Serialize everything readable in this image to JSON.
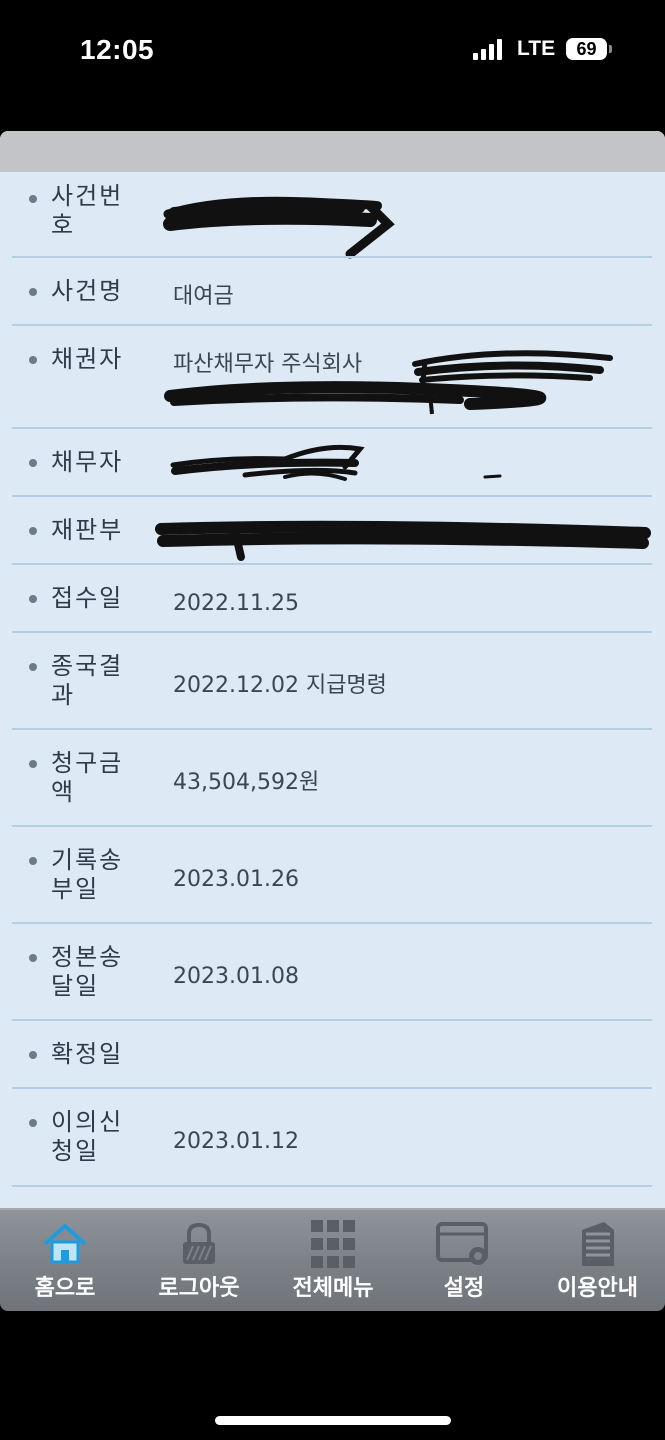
{
  "status_bar": {
    "time": "12:05",
    "network": "LTE",
    "battery": "69",
    "signal_icon": "signal-bars-icon"
  },
  "case": {
    "case_number": {
      "label": "사건번호",
      "value": ""
    },
    "case_name": {
      "label": "사건명",
      "value": "대여금"
    },
    "creditor": {
      "label": "채권자",
      "value": "파산채무자 주식회사"
    },
    "debtor": {
      "label": "채무자",
      "value": ""
    },
    "court_division": {
      "label": "재판부",
      "value": ""
    },
    "filing_date": {
      "label": "접수일",
      "value": "2022.11.25"
    },
    "final_result": {
      "label": "종국결과",
      "value": "2022.12.02 지급명령"
    },
    "claim_amount": {
      "label": "청구금액",
      "value": "43,504,592원"
    },
    "record_sent_date": {
      "label": "기록송부일",
      "value": "2023.01.26"
    },
    "original_delivered_date": {
      "label": "정본송달일",
      "value": "2023.01.08"
    },
    "confirmed_date": {
      "label": "확정일",
      "value": ""
    },
    "objection_date": {
      "label": "이의신청일",
      "value": "2023.01.12"
    }
  },
  "tabbar": {
    "items": [
      {
        "label": "홈으로",
        "icon": "home-icon"
      },
      {
        "label": "로그아웃",
        "icon": "lock-icon"
      },
      {
        "label": "전체메뉴",
        "icon": "grid-menu-icon"
      },
      {
        "label": "설정",
        "icon": "settings-icon"
      },
      {
        "label": "이용안내",
        "icon": "document-icon"
      }
    ]
  },
  "colors": {
    "panel_bg": "#ddeaf5",
    "header_bg": "#c3c4c7",
    "home_icon": "#1e9be0",
    "tab_icon": "#5a5f66"
  }
}
